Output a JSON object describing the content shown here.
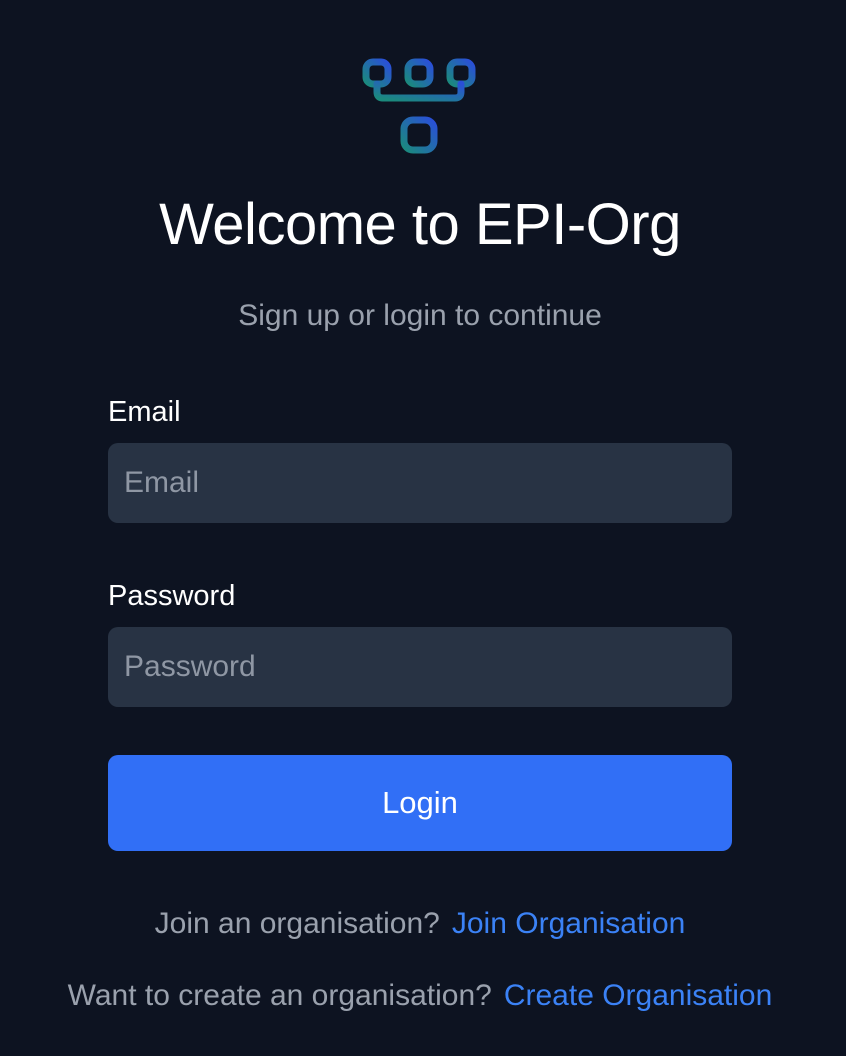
{
  "brand": {
    "logo_icon": "org-tree-icon",
    "colors": {
      "background": "#0d1321",
      "logo_gradient_start": "#2a4fd8",
      "logo_gradient_end": "#1b8a7d",
      "primary": "#316ff6",
      "link": "#3b82f6"
    }
  },
  "header": {
    "title": "Welcome to EPI-Org",
    "subtitle": "Sign up or login to continue"
  },
  "form": {
    "email": {
      "label": "Email",
      "placeholder": "Email",
      "value": ""
    },
    "password": {
      "label": "Password",
      "placeholder": "Password",
      "value": ""
    },
    "login_label": "Login"
  },
  "footer": {
    "join_prompt": "Join an organisation?",
    "join_link": "Join Organisation",
    "create_prompt": "Want to create an organisation?",
    "create_link": "Create Organisation"
  }
}
